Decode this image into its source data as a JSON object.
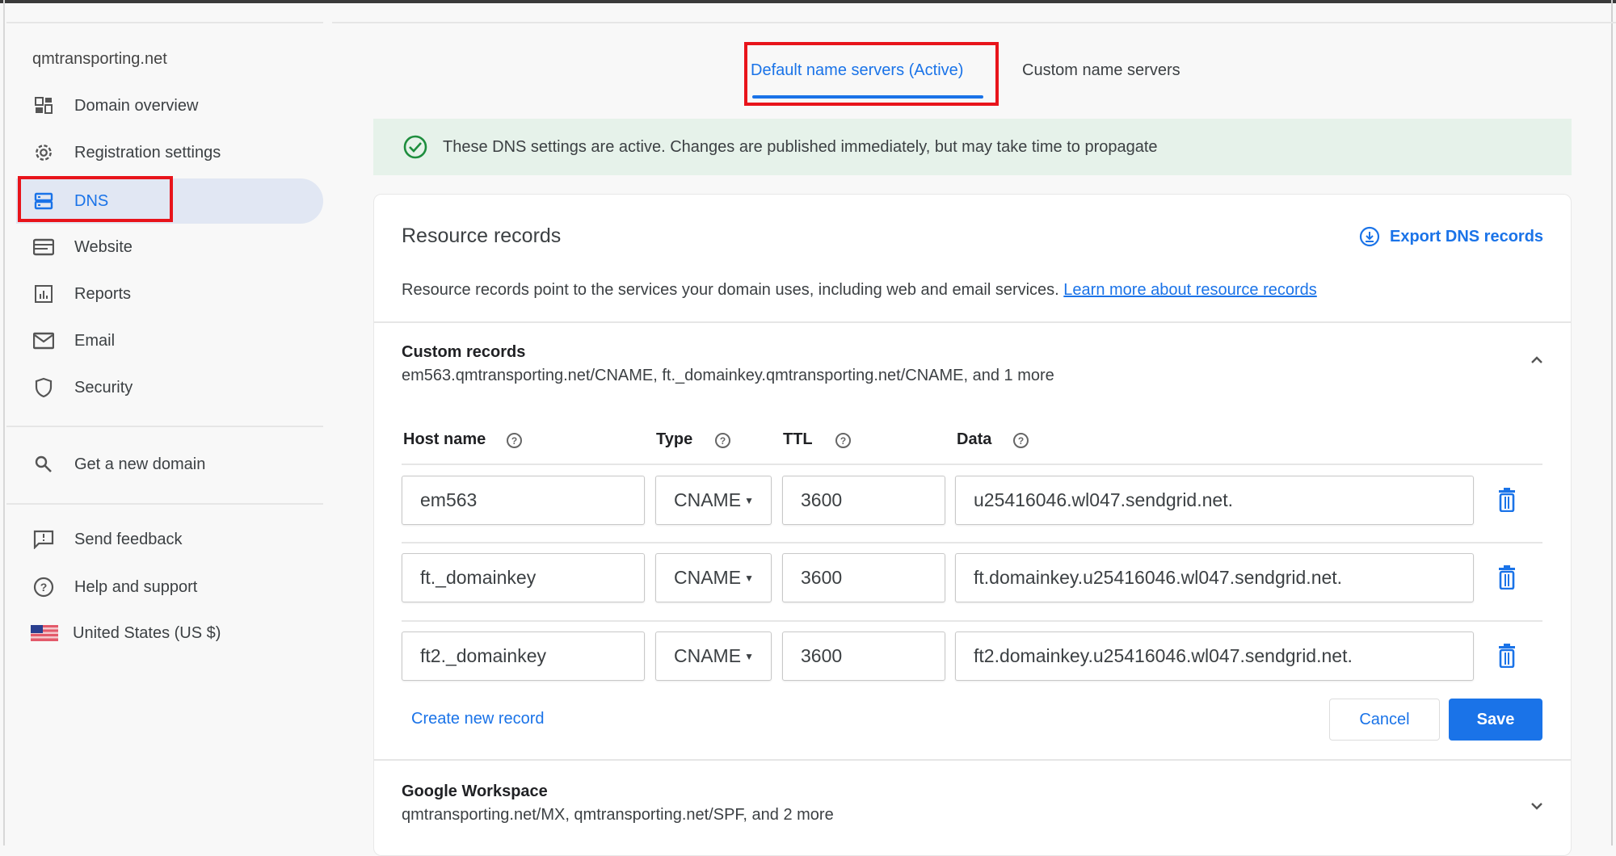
{
  "sidebar": {
    "domain": "qmtransporting.net",
    "items": [
      {
        "label": "Domain overview",
        "icon": "dashboard-icon"
      },
      {
        "label": "Registration settings",
        "icon": "gear-icon"
      },
      {
        "label": "DNS",
        "icon": "dns-icon"
      },
      {
        "label": "Website",
        "icon": "website-icon"
      },
      {
        "label": "Reports",
        "icon": "chart-icon"
      },
      {
        "label": "Email",
        "icon": "mail-icon"
      },
      {
        "label": "Security",
        "icon": "shield-icon"
      }
    ],
    "get_domain": "Get a new domain",
    "feedback": "Send feedback",
    "help": "Help and support",
    "region": "United States (US $)"
  },
  "tabs": {
    "default": "Default name servers (Active)",
    "custom": "Custom name servers"
  },
  "banner": "These DNS settings are active. Changes are published immediately, but may take time to propagate",
  "resource": {
    "title": "Resource records",
    "export": "Export DNS records",
    "description": "Resource records point to the services your domain uses, including web and email services.",
    "learn_more": "Learn more about resource records"
  },
  "custom": {
    "title": "Custom records",
    "summary": "em563.qmtransporting.net/CNAME, ft._domainkey.qmtransporting.net/CNAME, and 1 more",
    "headers": {
      "host": "Host name",
      "type": "Type",
      "ttl": "TTL",
      "data": "Data"
    },
    "records": [
      {
        "host": "em563",
        "type": "CNAME",
        "ttl": "3600",
        "data": "u25416046.wl047.sendgrid.net."
      },
      {
        "host": "ft._domainkey",
        "type": "CNAME",
        "ttl": "3600",
        "data": "ft.domainkey.u25416046.wl047.sendgrid.net."
      },
      {
        "host": "ft2._domainkey",
        "type": "CNAME",
        "ttl": "3600",
        "data": "ft2.domainkey.u25416046.wl047.sendgrid.net."
      }
    ],
    "create": "Create new record",
    "cancel": "Cancel",
    "save": "Save"
  },
  "workspace": {
    "title": "Google Workspace",
    "summary": "qmtransporting.net/MX, qmtransporting.net/SPF, and 2 more"
  },
  "colors": {
    "accent": "#1a73e8",
    "highlight": "#e8141b",
    "success": "#1e8e3e"
  }
}
